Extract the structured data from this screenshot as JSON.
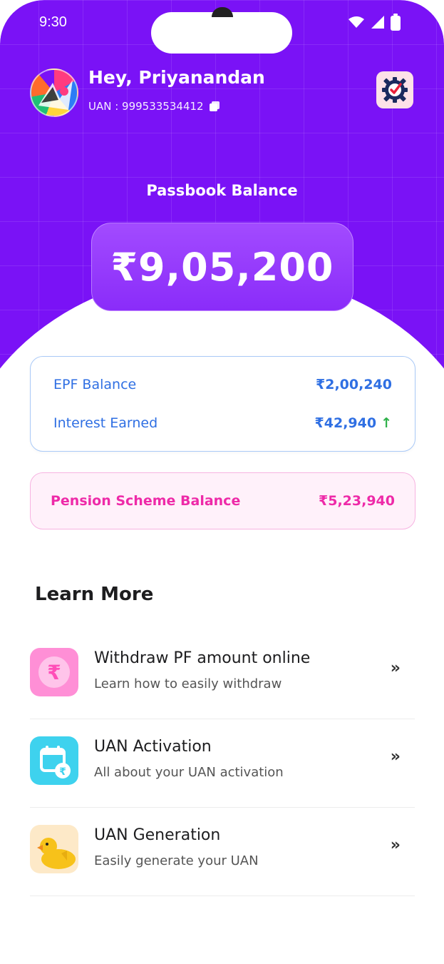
{
  "status_bar": {
    "time": "9:30"
  },
  "header": {
    "greeting": "Hey, Priyanandan",
    "uan_label": "UAN : 999533534412"
  },
  "balance": {
    "label": "Passbook Balance",
    "value": "₹9,05,200"
  },
  "epf": {
    "balance_label": "EPF Balance",
    "balance_value": "₹2,00,240",
    "interest_label": "Interest Earned",
    "interest_value": "₹42,940",
    "interest_trend": "↑"
  },
  "pension": {
    "label": "Pension Scheme Balance",
    "value": "₹5,23,940"
  },
  "learn_more": {
    "title": "Learn More",
    "items": [
      {
        "title": "Withdraw PF amount online",
        "subtitle": "Learn how to easily withdraw",
        "chevron": "»",
        "icon": "rupee-icon"
      },
      {
        "title": "UAN Activation",
        "subtitle": "All about your UAN activation",
        "chevron": "»",
        "icon": "calendar-rupee-icon"
      },
      {
        "title": "UAN Generation",
        "subtitle": "Easily generate your UAN",
        "chevron": "»",
        "icon": "duck-icon"
      }
    ]
  },
  "colors": {
    "brand_purple": "#7a12f6",
    "epf_blue": "#2f6fe3",
    "pension_pink": "#ee2aa8",
    "trend_green": "#2fb14a"
  }
}
